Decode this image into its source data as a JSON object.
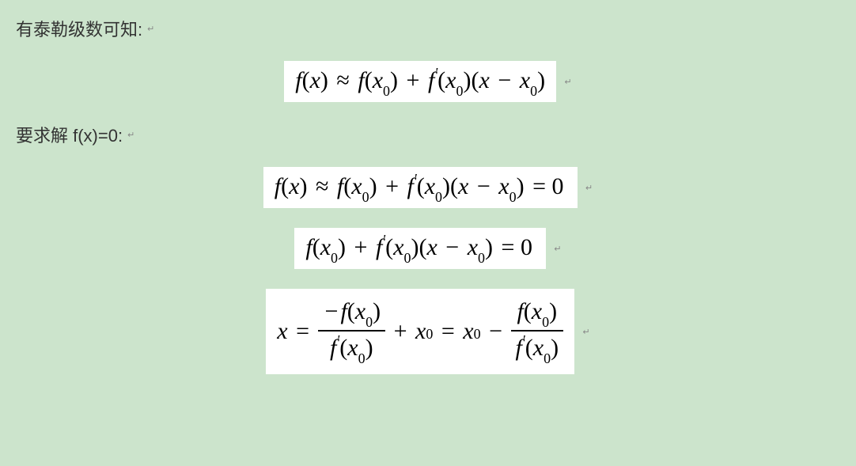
{
  "line1": "有泰勒级数可知:",
  "line2": "要求解 f(x)=0:",
  "paraMark": "↵",
  "eq1": {
    "fx": "f",
    "x": "x",
    "approx": "≈",
    "x0": "x",
    "zero": "0",
    "plus": "+",
    "prime": "'",
    "minus": "−",
    "lp": "(",
    "rp": ")"
  },
  "eq2": {
    "eqzero": "= 0"
  },
  "eq4": {
    "xeq": "x",
    "eq": "=",
    "neg": "−"
  }
}
